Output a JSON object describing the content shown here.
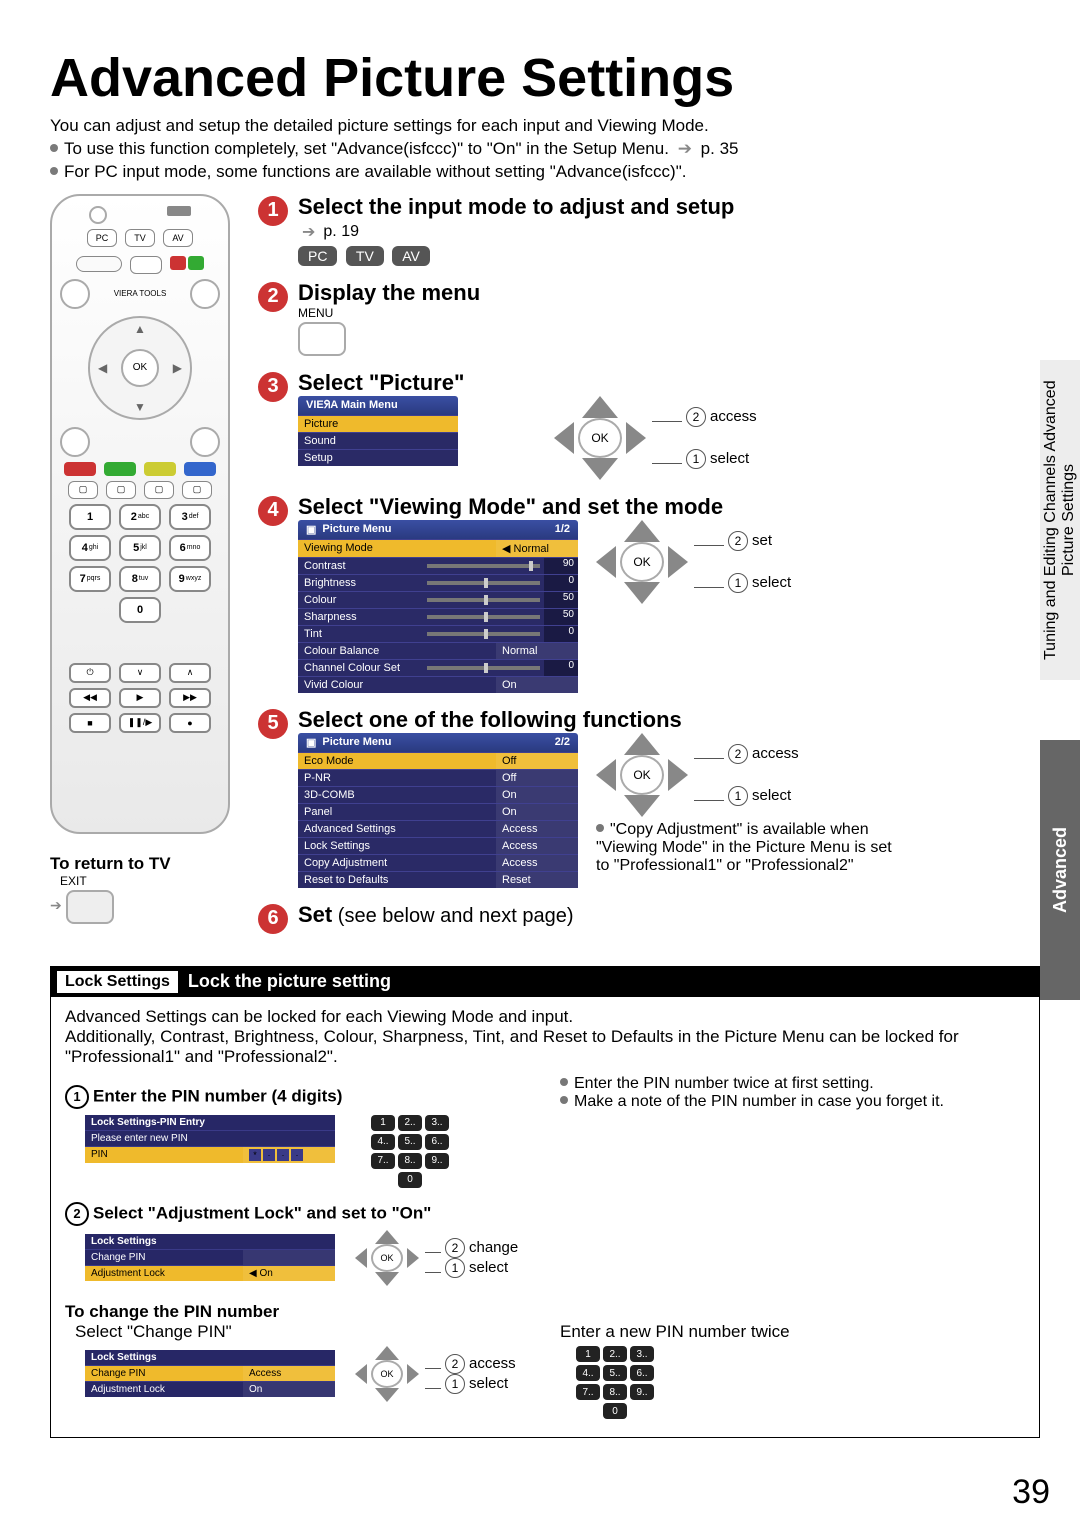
{
  "title": "Advanced Picture Settings",
  "intro": {
    "line1": "You can adjust and setup the detailed picture settings for each input and Viewing Mode.",
    "line2a": "To use this function completely, set \"Advance(isfccc)\" to \"On\" in the Setup Menu.",
    "line2b": "p. 35",
    "line3": "For PC input mode, some functions are available without setting \"Advance(isfccc)\"."
  },
  "side1": "Tuning and Editing Channels\nAdvanced Picture Settings",
  "side2": "Advanced",
  "remote": {
    "topRow": [
      "PC",
      "TV",
      "AV"
    ],
    "viera": "VIERA TOOLS",
    "ok": "OK",
    "nums": [
      "1",
      "2abc",
      "3def",
      "4ghi",
      "5jkl",
      "6mno",
      "7pqrs",
      "8tuv",
      "9wxyz",
      "0"
    ]
  },
  "returnTv": {
    "title": "To return to TV",
    "exit": "EXIT"
  },
  "steps": {
    "s1": {
      "title": "Select the input mode to adjust and setup",
      "pref": "p. 19",
      "modes": [
        "PC",
        "TV",
        "AV"
      ]
    },
    "s2": {
      "title": "Display the menu",
      "menu": "MENU"
    },
    "s3": {
      "title": "Select \"Picture\"",
      "nav": {
        "access": "access",
        "select": "select",
        "n2": "2",
        "n1": "1",
        "ok": "OK"
      },
      "osd": {
        "header": "VIEᖆA Main Menu",
        "items": [
          "Picture",
          "Sound",
          "Setup"
        ]
      }
    },
    "s4": {
      "title": "Select \"Viewing Mode\" and set the mode",
      "nav": {
        "set": "set",
        "select": "select",
        "n2": "2",
        "n1": "1",
        "ok": "OK"
      },
      "osd": {
        "header": "Picture Menu",
        "page": "1/2",
        "rows": [
          {
            "l": "Viewing Mode",
            "v": "Normal",
            "sel": true,
            "type": "lr"
          },
          {
            "l": "Contrast",
            "num": "90",
            "pos": 90
          },
          {
            "l": "Brightness",
            "num": "0",
            "pos": 50
          },
          {
            "l": "Colour",
            "num": "50",
            "pos": 50
          },
          {
            "l": "Sharpness",
            "num": "50",
            "pos": 50
          },
          {
            "l": "Tint",
            "num": "0",
            "pos": 50
          },
          {
            "l": "Colour Balance",
            "v": "Normal",
            "type": "txt"
          },
          {
            "l": "Channel Colour Set",
            "num": "0",
            "pos": 50
          },
          {
            "l": "Vivid Colour",
            "v": "On",
            "type": "txt"
          }
        ]
      }
    },
    "s5": {
      "title": "Select one of the following functions",
      "nav": {
        "access": "access",
        "select": "select",
        "n2": "2",
        "n1": "1",
        "ok": "OK"
      },
      "note": "\"Copy Adjustment\" is available when \"Viewing Mode\" in the Picture Menu is set to \"Professional1\" or \"Professional2\"",
      "osd": {
        "header": "Picture Menu",
        "page": "2/2",
        "rows": [
          {
            "l": "Eco Mode",
            "v": "Off",
            "sel": true
          },
          {
            "l": "P-NR",
            "v": "Off"
          },
          {
            "l": "3D-COMB",
            "v": "On"
          },
          {
            "l": "Panel",
            "v": "On"
          },
          {
            "l": "Advanced Settings",
            "v": "Access"
          },
          {
            "l": "Lock Settings",
            "v": "Access"
          },
          {
            "l": "Copy Adjustment",
            "v": "Access"
          },
          {
            "l": "Reset to Defaults",
            "v": "Reset"
          }
        ]
      }
    },
    "s6": {
      "title": "Set",
      "sub": " (see below and next page)"
    }
  },
  "lock": {
    "tag": "Lock Settings",
    "head": "Lock the picture setting",
    "desc": "Advanced Settings can be locked for each Viewing Mode and input.\nAdditionally, Contrast, Brightness, Colour, Sharpness, Tint, and Reset to Defaults in the Picture Menu can be locked for \"Professional1\" and \"Professional2\".",
    "sub1": {
      "n": "1",
      "t": "Enter the PIN number (4 digits)"
    },
    "right1a": "Enter the PIN number twice at first setting.",
    "right1b": "Make a note of the PIN number in case you forget it.",
    "pinOsd": {
      "bar": "Lock Settings-PIN Entry",
      "row1": "Please enter new PIN",
      "row2l": "PIN",
      "pinShown": "*"
    },
    "sub2": {
      "n": "2",
      "t": "Select \"Adjustment Lock\" and set to \"On\""
    },
    "adjOsd": {
      "bar": "Lock Settings",
      "r1": "Change PIN",
      "r2l": "Adjustment Lock",
      "r2v": "On"
    },
    "adjNav": {
      "change": "change",
      "select": "select",
      "n2": "2",
      "n1": "1",
      "ok": "OK"
    },
    "changeTitle": "To change the PIN number",
    "changeLine": "Select \"Change PIN\"",
    "changeRight": "Enter a new PIN number twice",
    "chOsd": {
      "bar": "Lock Settings",
      "r1l": "Change PIN",
      "r1v": "Access",
      "r2l": "Adjustment Lock",
      "r2v": "On"
    },
    "chNav": {
      "access": "access",
      "select": "select",
      "n2": "2",
      "n1": "1",
      "ok": "OK"
    }
  },
  "pageNum": "39"
}
